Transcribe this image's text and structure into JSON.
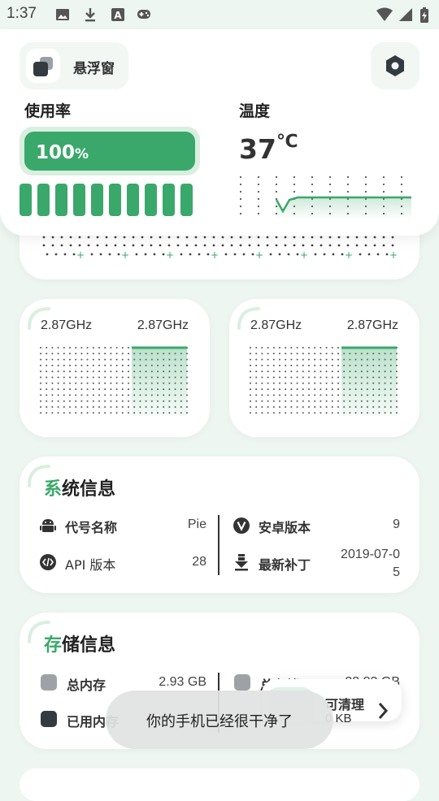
{
  "status_bar": {
    "time": "1:37",
    "left_icons": [
      "image-icon",
      "download-icon",
      "font-icon",
      "game-controller-icon"
    ],
    "right_icons": [
      "wifi-icon",
      "signal-icon",
      "battery-icon"
    ]
  },
  "header": {
    "float_window_label": "悬浮窗",
    "settings_icon": "hexagon-settings-icon"
  },
  "usage": {
    "label": "使用率",
    "percent_value": "100",
    "percent_sign": "%",
    "fill_fraction": 1.0,
    "core_count": 10
  },
  "temperature": {
    "label": "温度",
    "value": "37",
    "unit": "℃"
  },
  "freq_cards": [
    {
      "left_freq": "2.87GHz",
      "right_freq": "2.87GHz"
    },
    {
      "left_freq": "2.87GHz",
      "right_freq": "2.87GHz"
    }
  ],
  "system_info": {
    "title_first": "系",
    "title_rest": "统信息",
    "rows": [
      {
        "icon": "android-icon",
        "label": "代号名称",
        "value": "Pie"
      },
      {
        "icon": "code-icon",
        "label": "API 版本",
        "value": "28"
      },
      {
        "icon": "version-v-icon",
        "label": "安卓版本",
        "value": "9"
      },
      {
        "icon": "patch-download-icon",
        "label": "最新补丁",
        "value_line1": "2019-07-0",
        "value_line2": "5"
      }
    ]
  },
  "storage_info": {
    "title_first": "存",
    "title_rest": "储信息",
    "rows": [
      {
        "label": "总内存",
        "value": "2.93 GB",
        "color": "#9ea2a6"
      },
      {
        "label": "已用内存",
        "value": "",
        "color": "#333a40"
      },
      {
        "label": "总存储",
        "value": "22.83 GB",
        "color": "#9ea2a6"
      }
    ]
  },
  "clean": {
    "label": "可清理",
    "size": "0 KB"
  },
  "toast": {
    "message": "你的手机已经很干净了"
  },
  "colors": {
    "accent": "#3aa86a",
    "accent_light": "#d9efe0",
    "background": "#eef6f1"
  }
}
